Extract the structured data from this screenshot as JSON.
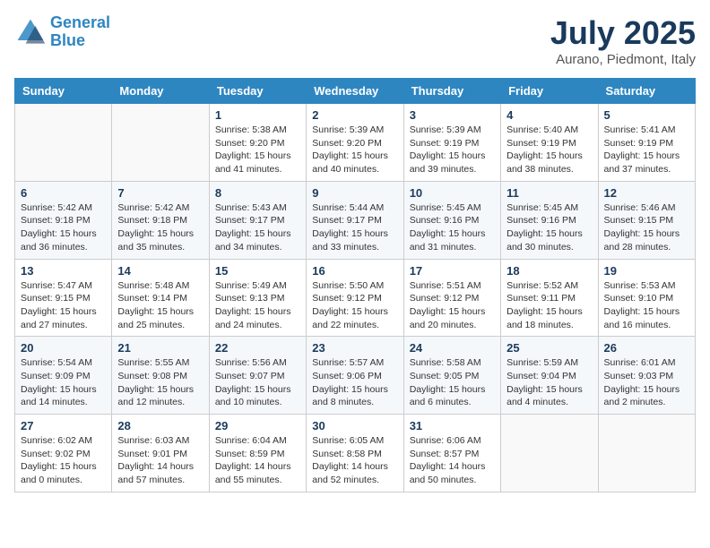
{
  "header": {
    "logo_line1": "General",
    "logo_line2": "Blue",
    "month_year": "July 2025",
    "location": "Aurano, Piedmont, Italy"
  },
  "weekdays": [
    "Sunday",
    "Monday",
    "Tuesday",
    "Wednesday",
    "Thursday",
    "Friday",
    "Saturday"
  ],
  "weeks": [
    [
      {
        "day": "",
        "sunrise": "",
        "sunset": "",
        "daylight": ""
      },
      {
        "day": "",
        "sunrise": "",
        "sunset": "",
        "daylight": ""
      },
      {
        "day": "1",
        "sunrise": "Sunrise: 5:38 AM",
        "sunset": "Sunset: 9:20 PM",
        "daylight": "Daylight: 15 hours and 41 minutes."
      },
      {
        "day": "2",
        "sunrise": "Sunrise: 5:39 AM",
        "sunset": "Sunset: 9:20 PM",
        "daylight": "Daylight: 15 hours and 40 minutes."
      },
      {
        "day": "3",
        "sunrise": "Sunrise: 5:39 AM",
        "sunset": "Sunset: 9:19 PM",
        "daylight": "Daylight: 15 hours and 39 minutes."
      },
      {
        "day": "4",
        "sunrise": "Sunrise: 5:40 AM",
        "sunset": "Sunset: 9:19 PM",
        "daylight": "Daylight: 15 hours and 38 minutes."
      },
      {
        "day": "5",
        "sunrise": "Sunrise: 5:41 AM",
        "sunset": "Sunset: 9:19 PM",
        "daylight": "Daylight: 15 hours and 37 minutes."
      }
    ],
    [
      {
        "day": "6",
        "sunrise": "Sunrise: 5:42 AM",
        "sunset": "Sunset: 9:18 PM",
        "daylight": "Daylight: 15 hours and 36 minutes."
      },
      {
        "day": "7",
        "sunrise": "Sunrise: 5:42 AM",
        "sunset": "Sunset: 9:18 PM",
        "daylight": "Daylight: 15 hours and 35 minutes."
      },
      {
        "day": "8",
        "sunrise": "Sunrise: 5:43 AM",
        "sunset": "Sunset: 9:17 PM",
        "daylight": "Daylight: 15 hours and 34 minutes."
      },
      {
        "day": "9",
        "sunrise": "Sunrise: 5:44 AM",
        "sunset": "Sunset: 9:17 PM",
        "daylight": "Daylight: 15 hours and 33 minutes."
      },
      {
        "day": "10",
        "sunrise": "Sunrise: 5:45 AM",
        "sunset": "Sunset: 9:16 PM",
        "daylight": "Daylight: 15 hours and 31 minutes."
      },
      {
        "day": "11",
        "sunrise": "Sunrise: 5:45 AM",
        "sunset": "Sunset: 9:16 PM",
        "daylight": "Daylight: 15 hours and 30 minutes."
      },
      {
        "day": "12",
        "sunrise": "Sunrise: 5:46 AM",
        "sunset": "Sunset: 9:15 PM",
        "daylight": "Daylight: 15 hours and 28 minutes."
      }
    ],
    [
      {
        "day": "13",
        "sunrise": "Sunrise: 5:47 AM",
        "sunset": "Sunset: 9:15 PM",
        "daylight": "Daylight: 15 hours and 27 minutes."
      },
      {
        "day": "14",
        "sunrise": "Sunrise: 5:48 AM",
        "sunset": "Sunset: 9:14 PM",
        "daylight": "Daylight: 15 hours and 25 minutes."
      },
      {
        "day": "15",
        "sunrise": "Sunrise: 5:49 AM",
        "sunset": "Sunset: 9:13 PM",
        "daylight": "Daylight: 15 hours and 24 minutes."
      },
      {
        "day": "16",
        "sunrise": "Sunrise: 5:50 AM",
        "sunset": "Sunset: 9:12 PM",
        "daylight": "Daylight: 15 hours and 22 minutes."
      },
      {
        "day": "17",
        "sunrise": "Sunrise: 5:51 AM",
        "sunset": "Sunset: 9:12 PM",
        "daylight": "Daylight: 15 hours and 20 minutes."
      },
      {
        "day": "18",
        "sunrise": "Sunrise: 5:52 AM",
        "sunset": "Sunset: 9:11 PM",
        "daylight": "Daylight: 15 hours and 18 minutes."
      },
      {
        "day": "19",
        "sunrise": "Sunrise: 5:53 AM",
        "sunset": "Sunset: 9:10 PM",
        "daylight": "Daylight: 15 hours and 16 minutes."
      }
    ],
    [
      {
        "day": "20",
        "sunrise": "Sunrise: 5:54 AM",
        "sunset": "Sunset: 9:09 PM",
        "daylight": "Daylight: 15 hours and 14 minutes."
      },
      {
        "day": "21",
        "sunrise": "Sunrise: 5:55 AM",
        "sunset": "Sunset: 9:08 PM",
        "daylight": "Daylight: 15 hours and 12 minutes."
      },
      {
        "day": "22",
        "sunrise": "Sunrise: 5:56 AM",
        "sunset": "Sunset: 9:07 PM",
        "daylight": "Daylight: 15 hours and 10 minutes."
      },
      {
        "day": "23",
        "sunrise": "Sunrise: 5:57 AM",
        "sunset": "Sunset: 9:06 PM",
        "daylight": "Daylight: 15 hours and 8 minutes."
      },
      {
        "day": "24",
        "sunrise": "Sunrise: 5:58 AM",
        "sunset": "Sunset: 9:05 PM",
        "daylight": "Daylight: 15 hours and 6 minutes."
      },
      {
        "day": "25",
        "sunrise": "Sunrise: 5:59 AM",
        "sunset": "Sunset: 9:04 PM",
        "daylight": "Daylight: 15 hours and 4 minutes."
      },
      {
        "day": "26",
        "sunrise": "Sunrise: 6:01 AM",
        "sunset": "Sunset: 9:03 PM",
        "daylight": "Daylight: 15 hours and 2 minutes."
      }
    ],
    [
      {
        "day": "27",
        "sunrise": "Sunrise: 6:02 AM",
        "sunset": "Sunset: 9:02 PM",
        "daylight": "Daylight: 15 hours and 0 minutes."
      },
      {
        "day": "28",
        "sunrise": "Sunrise: 6:03 AM",
        "sunset": "Sunset: 9:01 PM",
        "daylight": "Daylight: 14 hours and 57 minutes."
      },
      {
        "day": "29",
        "sunrise": "Sunrise: 6:04 AM",
        "sunset": "Sunset: 8:59 PM",
        "daylight": "Daylight: 14 hours and 55 minutes."
      },
      {
        "day": "30",
        "sunrise": "Sunrise: 6:05 AM",
        "sunset": "Sunset: 8:58 PM",
        "daylight": "Daylight: 14 hours and 52 minutes."
      },
      {
        "day": "31",
        "sunrise": "Sunrise: 6:06 AM",
        "sunset": "Sunset: 8:57 PM",
        "daylight": "Daylight: 14 hours and 50 minutes."
      },
      {
        "day": "",
        "sunrise": "",
        "sunset": "",
        "daylight": ""
      },
      {
        "day": "",
        "sunrise": "",
        "sunset": "",
        "daylight": ""
      }
    ]
  ]
}
